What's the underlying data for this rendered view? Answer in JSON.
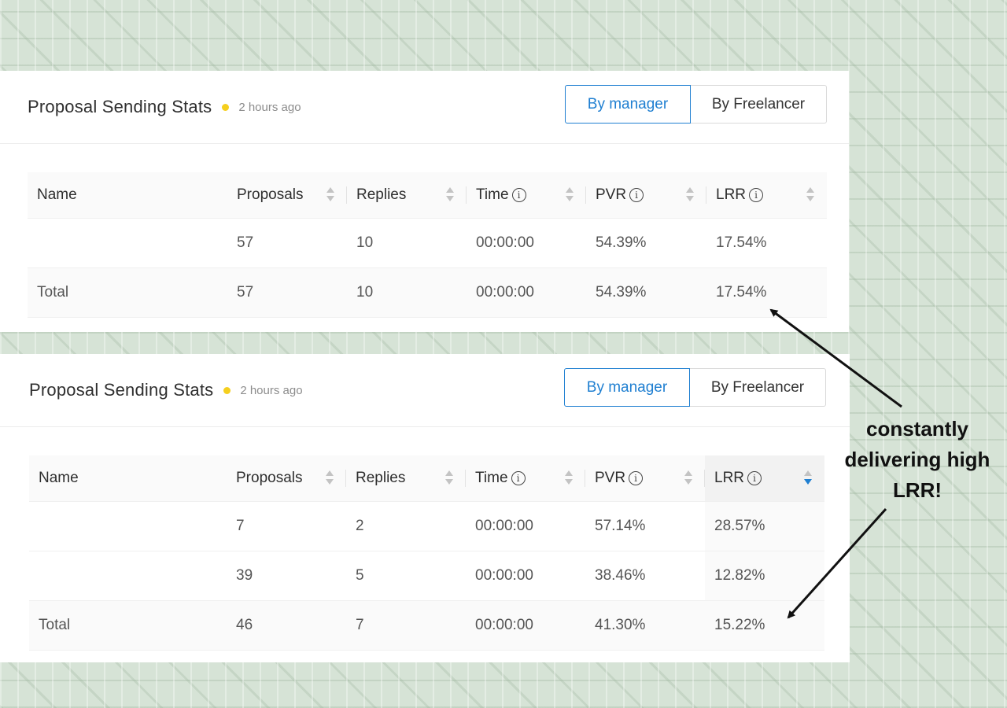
{
  "panels": [
    {
      "title": "Proposal Sending Stats",
      "updated": "2 hours ago",
      "toggle": {
        "active": "By manager",
        "inactive": "By Freelancer"
      },
      "columns": [
        "Name",
        "Proposals",
        "Replies",
        "Time",
        "PVR",
        "LRR"
      ],
      "rows": [
        {
          "name": "",
          "proposals": "57",
          "replies": "10",
          "time": "00:00:00",
          "pvr": "54.39%",
          "lrr": "17.54%"
        }
      ],
      "total": {
        "name": "Total",
        "proposals": "57",
        "replies": "10",
        "time": "00:00:00",
        "pvr": "54.39%",
        "lrr": "17.54%"
      }
    },
    {
      "title": "Proposal Sending Stats",
      "updated": "2 hours ago",
      "toggle": {
        "active": "By manager",
        "inactive": "By Freelancer"
      },
      "columns": [
        "Name",
        "Proposals",
        "Replies",
        "Time",
        "PVR",
        "LRR"
      ],
      "sorted_column": "LRR",
      "rows": [
        {
          "name": "",
          "proposals": "7",
          "replies": "2",
          "time": "00:00:00",
          "pvr": "57.14%",
          "lrr": "28.57%"
        },
        {
          "name": "",
          "proposals": "39",
          "replies": "5",
          "time": "00:00:00",
          "pvr": "38.46%",
          "lrr": "12.82%"
        }
      ],
      "total": {
        "name": "Total",
        "proposals": "46",
        "replies": "7",
        "time": "00:00:00",
        "pvr": "41.30%",
        "lrr": "15.22%"
      }
    }
  ],
  "annotation": {
    "text": "constantly\ndelivering high\nLRR!"
  },
  "colors": {
    "accent": "#1f7fd1",
    "status_dot": "#f5cf1e"
  },
  "icons": {
    "info": "info-circle-icon",
    "sort": "sort-icon",
    "status": "status-dot-icon"
  }
}
